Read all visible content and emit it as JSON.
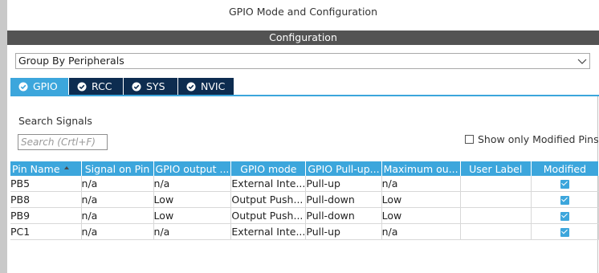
{
  "window": {
    "title": "GPIO Mode and Configuration"
  },
  "config_bar": {
    "label": "Configuration"
  },
  "group_select": {
    "value": "Group By Peripherals"
  },
  "tabs": [
    {
      "label": "GPIO",
      "active": true
    },
    {
      "label": "RCC",
      "active": false
    },
    {
      "label": "SYS",
      "active": false
    },
    {
      "label": "NVIC",
      "active": false
    }
  ],
  "search": {
    "label": "Search Signals",
    "placeholder": "Search (Crtl+F)"
  },
  "filter": {
    "show_modified_label": "Show only Modified Pins",
    "checked": false
  },
  "table": {
    "headers": [
      "Pin Name",
      "Signal on Pin",
      "GPIO output ...",
      "GPIO mode",
      "GPIO Pull-up...",
      "Maximum ou...",
      "User Label",
      "Modified"
    ],
    "rows": [
      {
        "pin": "PB5",
        "signal": "n/a",
        "output": "n/a",
        "mode": "External Inte...",
        "pull": "Pull-up",
        "max": "n/a",
        "label": "",
        "modified": true
      },
      {
        "pin": "PB8",
        "signal": "n/a",
        "output": "Low",
        "mode": "Output Push...",
        "pull": "Pull-down",
        "max": "Low",
        "label": "",
        "modified": true
      },
      {
        "pin": "PB9",
        "signal": "n/a",
        "output": "Low",
        "mode": "Output Push...",
        "pull": "Pull-down",
        "max": "Low",
        "label": "",
        "modified": true
      },
      {
        "pin": "PC1",
        "signal": "n/a",
        "output": "n/a",
        "mode": "External Inte...",
        "pull": "Pull-up",
        "max": "n/a",
        "label": "",
        "modified": true
      }
    ]
  },
  "colors": {
    "accent": "#3ca6dc",
    "tab_dark": "#0d2c50",
    "config_bar": "#535353"
  }
}
